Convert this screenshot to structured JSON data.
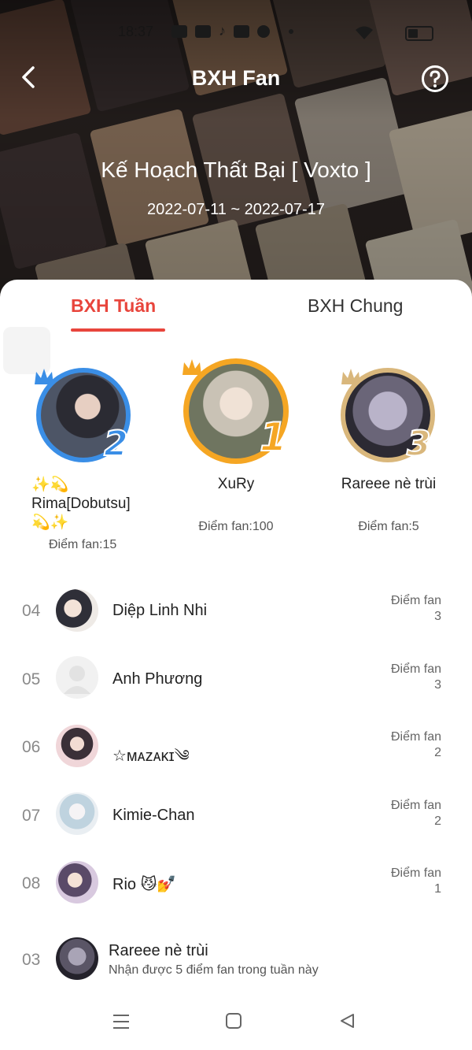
{
  "status_bar": {
    "time": "18:37"
  },
  "header": {
    "title": "BXH Fan",
    "song_title": "Kế Hoạch Thất Bại [ Voxto ]",
    "date_range": "2022-07-11 ~ 2022-07-17"
  },
  "tabs": [
    {
      "label": "BXH Tuần",
      "active": true
    },
    {
      "label": "BXH Chung",
      "active": false
    }
  ],
  "podium": [
    {
      "rank": "2",
      "name_line1": "✨💫",
      "name_line2": "Rima[Dobutsu]",
      "name_line3": "💫✨",
      "score": "Điểm fan:15",
      "ring_color": "#3a8ee6"
    },
    {
      "rank": "1",
      "name": "XuRy",
      "score": "Điểm fan:100",
      "ring_color": "#f5a623"
    },
    {
      "rank": "3",
      "name": "Rareee nè trùi",
      "score": "Điểm fan:5",
      "ring_color": "#d9b77c"
    }
  ],
  "list": [
    {
      "rank": "04",
      "name": "Diệp Linh Nhi",
      "label": "Điểm fan",
      "value": "3"
    },
    {
      "rank": "05",
      "name": "Anh Phương",
      "label": "Điểm fan",
      "value": "3"
    },
    {
      "rank": "06",
      "name": "☆ᴍᴀᴢᴀᴋɪ༄",
      "label": "Điểm fan",
      "value": "2"
    },
    {
      "rank": "07",
      "name": "Kimie-Chan",
      "label": "Điểm fan",
      "value": "2"
    },
    {
      "rank": "08",
      "name": "Rio 😼💅",
      "label": "Điểm fan",
      "value": "1"
    }
  ],
  "me": {
    "rank": "03",
    "name": "Rareee nè trùi",
    "subtitle": "Nhận được 5 điểm fan trong tuần này"
  },
  "colors": {
    "accent": "#e8453c",
    "gold": "#f5a623",
    "blue": "#3a8ee6",
    "bronze": "#d9b77c"
  }
}
